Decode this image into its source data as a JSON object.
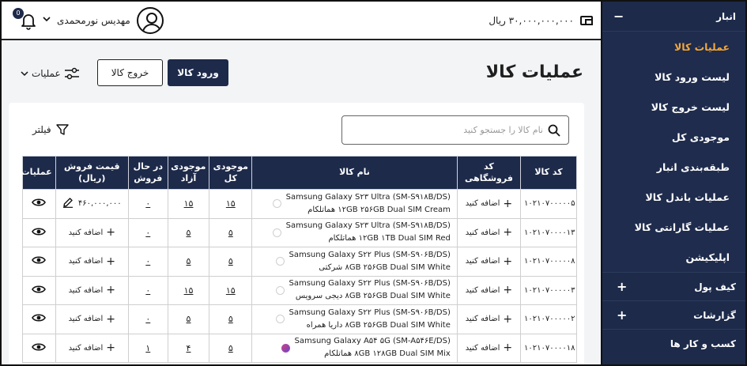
{
  "sidebar": {
    "section_title": "انبار",
    "section_toggle": "−",
    "items": [
      {
        "label": "عملیات کالا",
        "active": true
      },
      {
        "label": "لیست ورود کالا"
      },
      {
        "label": "لیست خروج کالا"
      },
      {
        "label": "موجودی کل"
      },
      {
        "label": "طبقه‌بندی انبار"
      },
      {
        "label": "عملیات باندل کالا"
      },
      {
        "label": "عملیات گارانتی کالا"
      },
      {
        "label": "اپلیکیشن"
      }
    ],
    "groups": [
      {
        "label": "کیف پول",
        "toggle": "+"
      },
      {
        "label": "گزارشات",
        "toggle": "+"
      },
      {
        "label": "کسب و کار ها",
        "toggle": ""
      }
    ]
  },
  "topbar": {
    "user_name": "مهدیس نورمحمدی",
    "notification_count": "0",
    "wallet_balance": "۳۰,۰۰۰,۰۰۰,۰۰۰ ریال"
  },
  "main": {
    "page_title": "عملیات کالا",
    "btn_in": "ورود کالا",
    "btn_out": "خروج کالا",
    "ops_label": "عملیات",
    "filter_label": "فیلتر",
    "search_placeholder": "نام کالا را جستجو کنید"
  },
  "table": {
    "headers": [
      "کد کالا",
      "کد فروشگاهی",
      "نام کالا",
      "موجودی کل",
      "موجودی آزاد",
      "در حال فروش",
      "قیمت فروش (ریال)",
      "عملیات"
    ],
    "add_label": "اضافه کنید",
    "rows": [
      {
        "code": "۱۰۲۱۰۷۰۰۰۰۰۵",
        "l1": "Samsung Galaxy S۲۳ Ultra (SM-S۹۱۸B/DS)",
        "l2": "۱۲GB ۲۵۶GB Dual SIM Cream هماتلکام",
        "total": "۱۵",
        "free": "۱۵",
        "selling": "۰",
        "price": "۴۶۰,۰۰۰,۰۰۰",
        "dot": "none"
      },
      {
        "code": "۱۰۲۱۰۷۰۰۰۰۱۳",
        "l1": "Samsung Galaxy S۲۳ Ultra (SM-S۹۱۸B/DS)",
        "l2": "۱۲GB ۱TB Dual SIM Red هماتلکام",
        "total": "۵",
        "free": "۵",
        "selling": "۰",
        "price": "",
        "dot": "none"
      },
      {
        "code": "۱۰۲۱۰۷۰۰۰۰۰۸",
        "l1": "Samsung Galaxy S۲۲ Plus (SM-S۹۰۶B/DS)",
        "l2": "۸GB ۲۵۶GB Dual SIM White شرکتی",
        "total": "۵",
        "free": "۵",
        "selling": "۰",
        "price": "",
        "dot": "none"
      },
      {
        "code": "۱۰۲۱۰۷۰۰۰۰۰۳",
        "l1": "Samsung Galaxy S۲۲ Plus (SM-S۹۰۶B/DS)",
        "l2": "۸GB ۲۵۶GB Dual SIM White دیجی سرویس",
        "total": "۱۵",
        "free": "۱۵",
        "selling": "۰",
        "price": "",
        "dot": "none"
      },
      {
        "code": "۱۰۲۱۰۷۰۰۰۰۰۲",
        "l1": "Samsung Galaxy S۲۲ Plus (SM-S۹۰۶B/DS)",
        "l2": "۸GB ۲۵۶GB Dual SIM White داریا همراه",
        "total": "۵",
        "free": "۵",
        "selling": "۰",
        "price": "",
        "dot": "none"
      },
      {
        "code": "۱۰۲۱۰۷۰۰۰۰۱۸",
        "l1": "Samsung Galaxy A۵۴ ۵G (SM-A۵۴۶E/DS)",
        "l2": "۸GB ۱۲۸GB Dual SIM Mix هماتلکام",
        "total": "۵",
        "free": "۴",
        "selling": "۱",
        "price": "",
        "dot": "gradient"
      }
    ]
  },
  "colors": {
    "primary": "#1d2a4a",
    "accent": "#f2a73b"
  }
}
